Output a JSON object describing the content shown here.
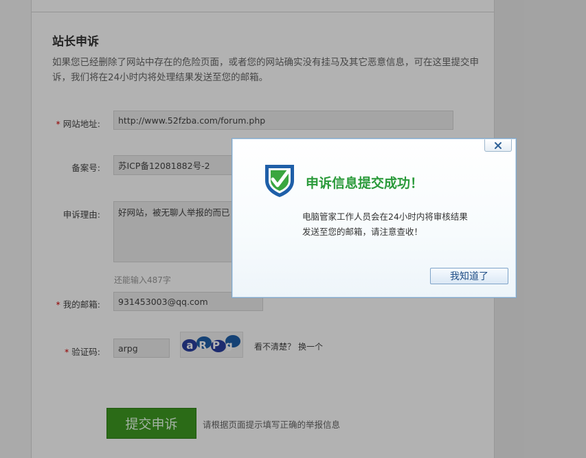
{
  "page": {
    "title": "站长申诉",
    "description": "如果您已经删除了网站中存在的危险页面，或者您的网站确实没有挂马及其它恶意信息，可在这里提交申诉，我们将在24小时内将处理结果发送至您的邮箱。"
  },
  "form": {
    "site_url": {
      "label": "网站地址:",
      "required": "*",
      "value": "http://www.52fzba.com/forum.php"
    },
    "icp": {
      "label": "备案号:",
      "value": "苏ICP备12081882号-2"
    },
    "reason": {
      "label": "申诉理由:",
      "value": "好网站，被无聊人举报的而已",
      "remaining": "还能输入487字"
    },
    "email": {
      "label": "我的邮箱:",
      "required": "*",
      "value": "931453003@qq.com"
    },
    "captcha": {
      "label": "验证码:",
      "required": "*",
      "value": "arpg",
      "image_text": "aRPg",
      "unclear": "看不清楚？",
      "refresh": "换一个"
    },
    "submit": {
      "label": "提交申诉",
      "hint": "请根据页面提示填写正确的举报信息"
    }
  },
  "dialog": {
    "close_icon": "close-icon",
    "shield_icon": "shield-check-icon",
    "title": "申诉信息提交成功！",
    "message_line1": "电脑管家工作人员会在24小时内将审核结果",
    "message_line2": "发送至您的邮箱，请注意查收！",
    "ok_label": "我知道了"
  },
  "colors": {
    "accent_green": "#3e9a22",
    "dialog_title": "#2a9a3a",
    "shield_blue": "#1f5fa8",
    "required_red": "#d40000"
  }
}
